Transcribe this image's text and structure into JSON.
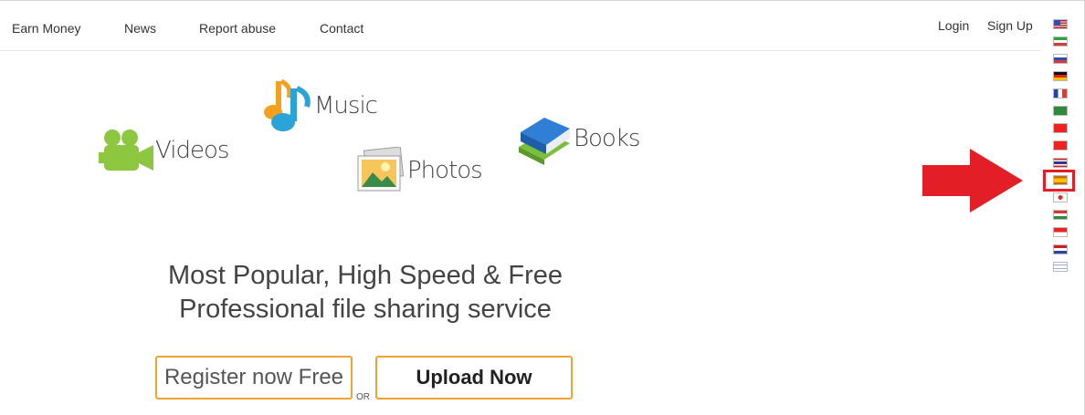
{
  "nav": {
    "earn_money": "Earn Money",
    "news": "News",
    "report_abuse": "Report abuse",
    "contact": "Contact",
    "login": "Login",
    "signup": "Sign Up"
  },
  "flags": [
    "us",
    "ir",
    "ru",
    "de",
    "fr",
    "sa",
    "tr",
    "cn",
    "th",
    "es",
    "jp",
    "hu",
    "id",
    "nl",
    "il"
  ],
  "highlighted_flag": "es",
  "categories": {
    "videos": "Videos",
    "music": "Music",
    "photos": "Photos",
    "books": "Books"
  },
  "headline": {
    "line1": "Most Popular, High Speed & Free",
    "line2": "Professional file sharing service"
  },
  "buttons": {
    "register": "Register now Free",
    "or": "OR",
    "upload": "Upload Now"
  },
  "colors": {
    "accent_orange": "#f0a333",
    "arrow_red": "#e31e26"
  }
}
